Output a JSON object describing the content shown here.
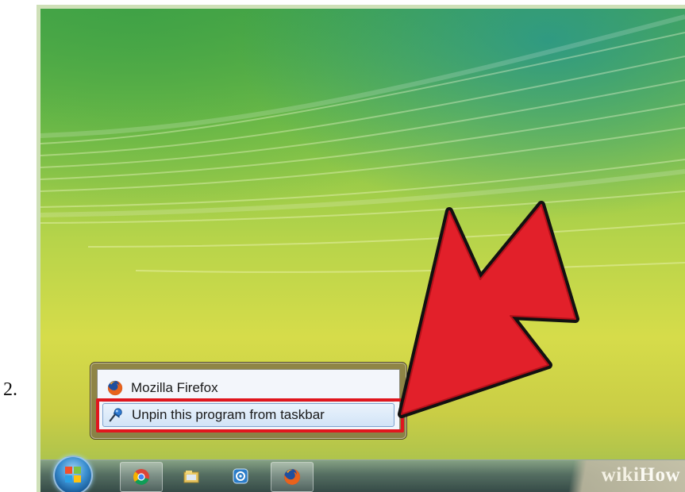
{
  "step": {
    "number": "2."
  },
  "jumplist": {
    "items": [
      {
        "label": "Mozilla Firefox",
        "icon": "firefox-icon"
      },
      {
        "label": "Unpin this program from taskbar",
        "icon": "unpin-icon"
      }
    ]
  },
  "taskbar": {
    "start_icon": "windows-start-orb",
    "buttons": [
      {
        "icon": "chrome-icon",
        "active": true
      },
      {
        "icon": "explorer-icon",
        "active": false
      },
      {
        "icon": "media-icon",
        "active": false
      },
      {
        "icon": "firefox-icon",
        "active": true
      }
    ]
  },
  "watermark": {
    "prefix": "wiki",
    "suffix": "How"
  },
  "colors": {
    "highlight": "#e0161e",
    "arrow": "#e2202a"
  }
}
